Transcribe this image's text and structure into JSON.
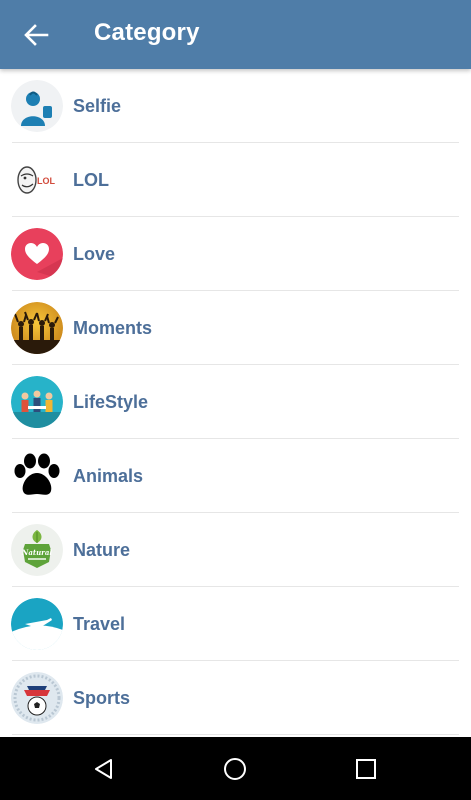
{
  "header": {
    "title": "Category",
    "back_icon": "arrow-left-icon",
    "background": "#4f7da8"
  },
  "categories": [
    {
      "label": "Selfie",
      "icon": "selfie-person-icon"
    },
    {
      "label": "LOL",
      "icon": "troll-face-lol-icon"
    },
    {
      "label": "Love",
      "icon": "heart-icon"
    },
    {
      "label": "Moments",
      "icon": "crowd-celebration-icon"
    },
    {
      "label": "LifeStyle",
      "icon": "people-lifestyle-icon"
    },
    {
      "label": "Animals",
      "icon": "paw-print-icon"
    },
    {
      "label": "Nature",
      "icon": "natural-badge-icon"
    },
    {
      "label": "Travel",
      "icon": "airplane-icon"
    },
    {
      "label": "Sports",
      "icon": "soccer-ball-icon"
    }
  ],
  "label_color": "#4d6f99",
  "system_nav": {
    "back_icon": "triangle-back-icon",
    "home_icon": "circle-home-icon",
    "recents_icon": "square-recents-icon"
  }
}
